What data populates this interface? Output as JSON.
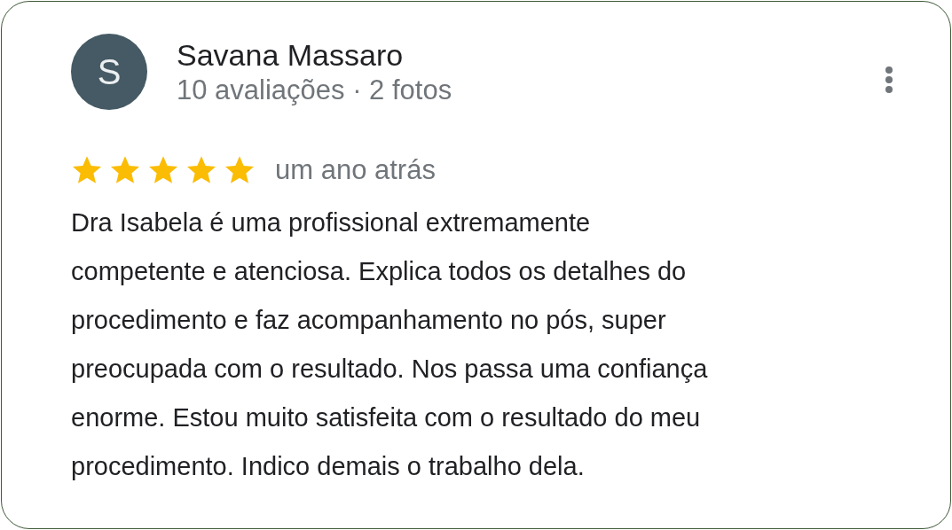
{
  "review": {
    "avatar_letter": "S",
    "author": "Savana Massaro",
    "meta": "10 avaliações · 2 fotos",
    "stars": 5,
    "time": "um ano atrás",
    "body_lines": [
      "Dra Isabela é uma profissional extremamente",
      "competente e atenciosa. Explica todos os detalhes do",
      "procedimento e faz acompanhamento no pós, super",
      "preocupada com o resultado. Nos passa uma confiança",
      "enorme. Estou muito satisfeita com o resultado do meu",
      "procedimento. Indico demais o trabalho dela."
    ]
  }
}
